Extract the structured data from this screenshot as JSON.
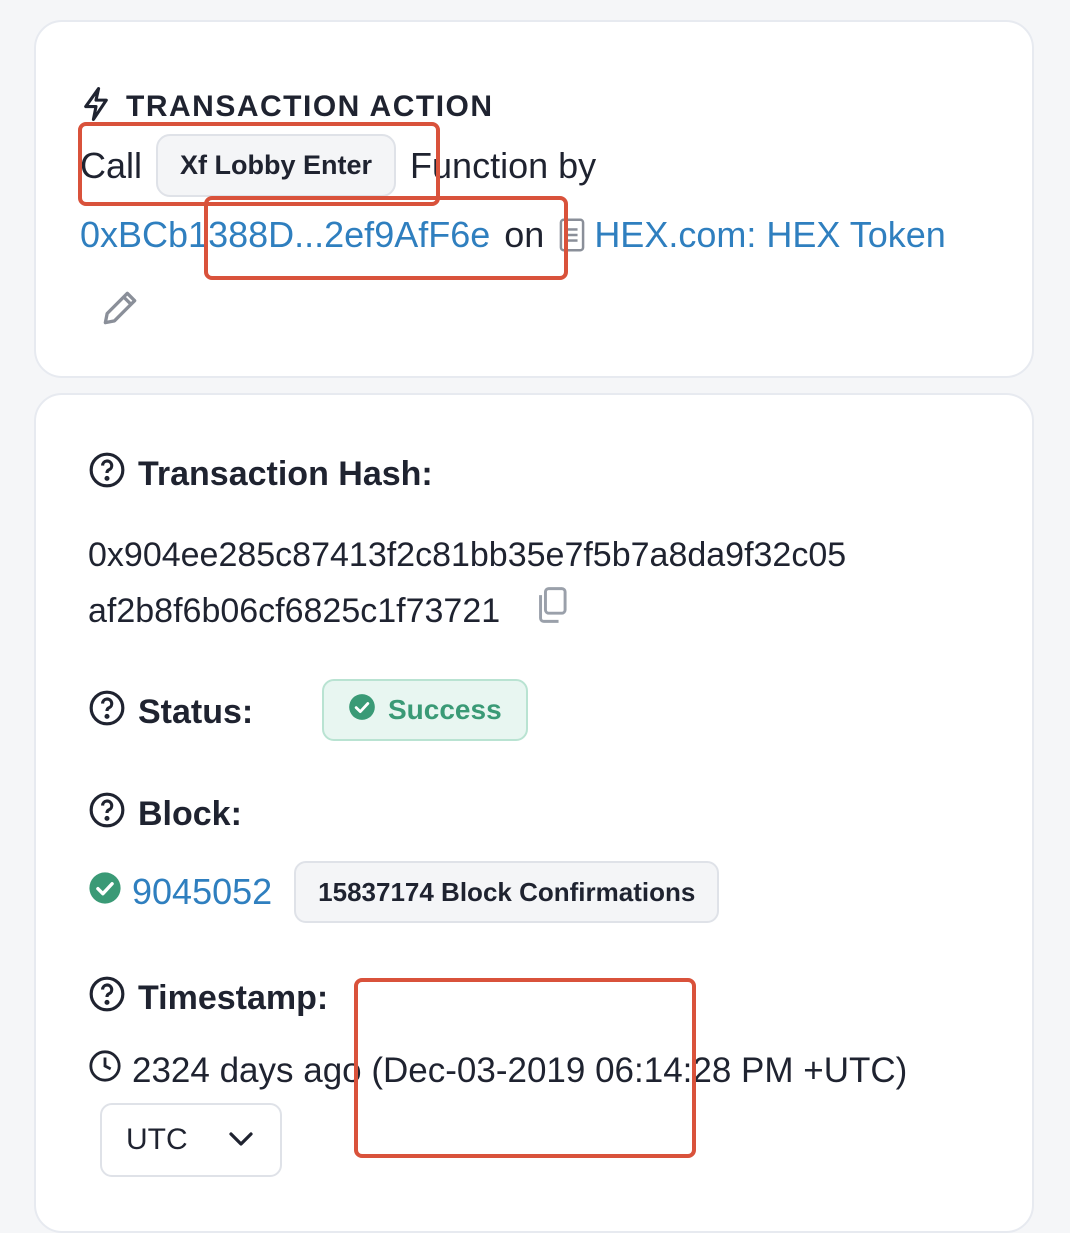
{
  "action": {
    "header": "TRANSACTION ACTION",
    "call_word": "Call",
    "function_name": "Xf Lobby Enter",
    "function_by": "Function by",
    "from_address": "0xBCb1388D...2ef9AfF6e",
    "on_word": "on",
    "contract_name": "HEX.com: HEX Token"
  },
  "details": {
    "hash_label": "Transaction Hash:",
    "hash_line1": "0x904ee285c87413f2c81bb35e7f5b7a8da9f32c05",
    "hash_line2": "af2b8f6b06cf6825c1f73721",
    "status_label": "Status:",
    "status_value": "Success",
    "block_label": "Block:",
    "block_number": "9045052",
    "block_confirmations": "15837174 Block Confirmations",
    "timestamp_label": "Timestamp:",
    "timestamp_value": "2324 days ago (Dec-03-2019 06:14:28 PM +UTC)",
    "timezone_selected": "UTC"
  },
  "colors": {
    "link": "#2f7fbf",
    "success": "#3a9a76",
    "highlight_box": "#d9523b"
  },
  "icons": [
    "lightning-icon",
    "document-icon",
    "pencil-icon",
    "help-circle-icon",
    "copy-icon",
    "check-circle-icon",
    "clock-icon",
    "chevron-down-icon"
  ]
}
